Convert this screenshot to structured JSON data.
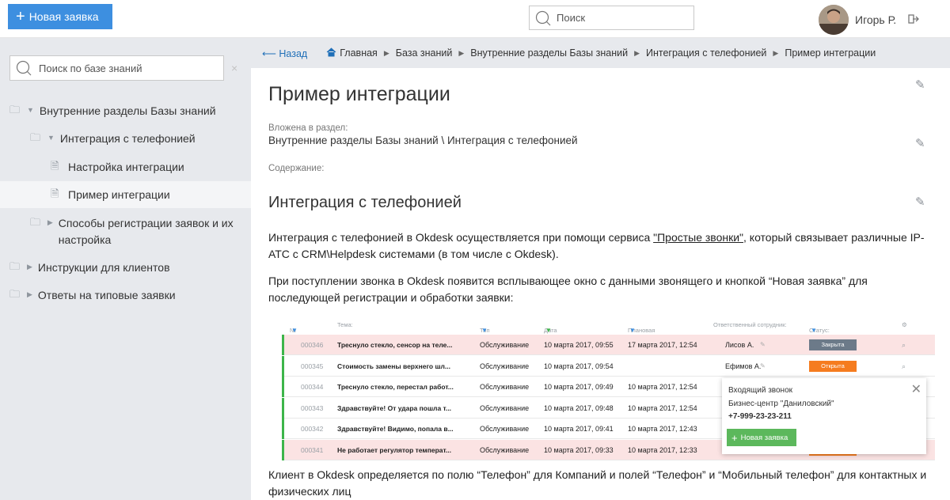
{
  "header": {
    "new_button_label": "Новая заявка",
    "search_placeholder": "Поиск",
    "user_name": "Игорь Р."
  },
  "sidebar": {
    "search_placeholder": "Поиск по базе знаний",
    "tree": [
      {
        "label": "Внутренние разделы Базы знаний",
        "type": "folder",
        "expanded": true,
        "level": 0
      },
      {
        "label": "Интеграция с телефонией",
        "type": "folder",
        "expanded": true,
        "level": 1
      },
      {
        "label": "Настройка интеграции",
        "type": "article",
        "level": 2
      },
      {
        "label": "Пример интеграции",
        "type": "article",
        "level": 2,
        "active": true
      },
      {
        "label": "Способы регистрации заявок и их настройка",
        "type": "folder",
        "expanded": false,
        "level": 1
      },
      {
        "label": "Инструкции для клиентов",
        "type": "folder",
        "expanded": false,
        "level": 0
      },
      {
        "label": "Ответы на типовые заявки",
        "type": "folder",
        "expanded": false,
        "level": 0
      }
    ]
  },
  "breadcrumb": {
    "back": "Назад",
    "items": [
      "Главная",
      "База знаний",
      "Внутренние разделы Базы знаний",
      "Интеграция с телефонией",
      "Пример интеграции"
    ]
  },
  "article": {
    "title": "Пример интеграции",
    "section_label": "Вложена в раздел:",
    "section_value": "Внутренние разделы Базы знаний \\ Интеграция с телефонией",
    "content_label": "Содержание:",
    "heading": "Интеграция с телефонией",
    "para1_before": "Интеграция с телефонией в Okdesk осуществляется при помощи сервиса ",
    "para1_link": "\"Простые звонки\"",
    "para1_after": ", который связывает различные IP-АТС с CRM\\Helpdesk системами (в том числе с Okdesk).",
    "para2": "При поступлении звонка в Okdesk появится всплывающее окно с данными звонящего и кнопкой “Новая заявка” для последующей регистрации и обработки заявки:",
    "para3": "Клиент в Okdesk определяется по полю “Телефон” для Компаний и полей “Телефон” и “Мобильный телефон” для контактных и физических лиц"
  },
  "screenshot": {
    "columns": [
      "№ заявки",
      "Тема:",
      "Тип заявки:",
      "Дата регистрации:",
      "Плановая дата решения:",
      "Ответственный сотрудник:",
      "Статус:"
    ],
    "rows": [
      {
        "num": "000346",
        "subject": "Треснуло стекло, сенсор на теле...",
        "type": "Обслуживание",
        "reg": "10 марта 2017, 09:55",
        "plan": "17 марта 2017, 12:54",
        "resp": "Лисов А.",
        "status": "Закрыта",
        "status_color": "#6c7a89",
        "bg": "#fbe3e3"
      },
      {
        "num": "000345",
        "subject": "Стоимость замены верхнего шл...",
        "type": "Обслуживание",
        "reg": "10 марта 2017, 09:54",
        "plan": "",
        "resp": "Ефимов А.",
        "status": "Открыта",
        "status_color": "#f57c1f",
        "bg": "#ffffff"
      },
      {
        "num": "000344",
        "subject": "Треснуло стекло, перестал работ...",
        "type": "Обслуживание",
        "reg": "10 марта 2017, 09:49",
        "plan": "10 марта 2017, 12:54",
        "resp": "",
        "status": "",
        "status_color": "#d0d4d9",
        "bg": "#ffffff"
      },
      {
        "num": "000343",
        "subject": "Здравствуйте! От удара пошла т...",
        "type": "Обслуживание",
        "reg": "10 марта 2017, 09:48",
        "plan": "10 марта 2017, 12:54",
        "resp": "",
        "status": "",
        "status_color": "#d0d4d9",
        "bg": "#ffffff"
      },
      {
        "num": "000342",
        "subject": "Здравствуйте! Видимо, попала в...",
        "type": "Обслуживание",
        "reg": "10 марта 2017, 09:41",
        "plan": "10 марта 2017, 12:43",
        "resp": "",
        "status": "",
        "status_color": "#d0d4d9",
        "bg": "#ffffff"
      },
      {
        "num": "000341",
        "subject": "Не работает регулятор температ...",
        "type": "Обслуживание",
        "reg": "10 марта 2017, 09:33",
        "plan": "10 марта 2017, 12:33",
        "resp": "",
        "status": "",
        "status_color": "#f57c1f",
        "bg": "#fbe3e3"
      }
    ],
    "popup": {
      "title": "Входящий звонок",
      "company": "Бизнес-центр \"Даниловский\"",
      "phone": "+7-999-23-23-211",
      "button": "Новая заявка"
    }
  },
  "colors": {
    "accent": "#3d8fe0",
    "sidebar_bg": "#e7e9ed",
    "green": "#3db54a",
    "orange": "#f57c1f"
  }
}
